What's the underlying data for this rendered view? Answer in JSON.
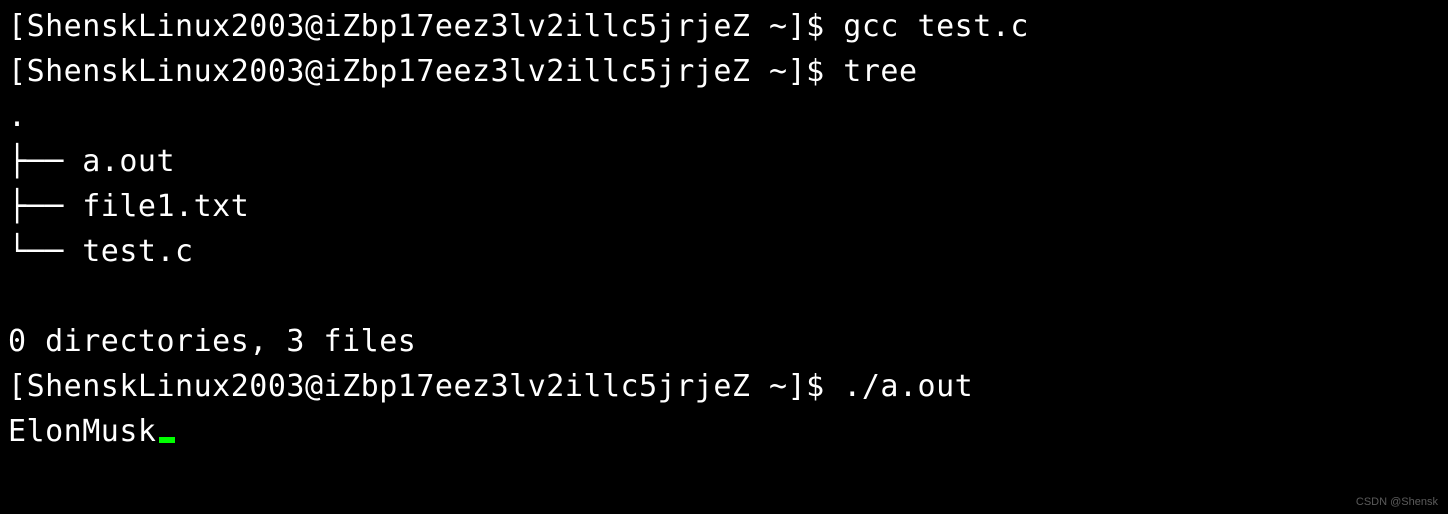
{
  "prompt_user": "ShenskLinux2003",
  "prompt_host": "iZbp17eez3lv2illc5jrjeZ",
  "prompt_dir": "~",
  "prompt_symbol": "$",
  "commands": {
    "cmd1": "gcc test.c",
    "cmd2": "tree",
    "cmd3": "./a.out"
  },
  "tree_output": {
    "root_marker": ".",
    "branch_mid": "├── ",
    "branch_last": "└── ",
    "files": {
      "f0": "a.out",
      "f1": "file1.txt",
      "f2": "test.c"
    },
    "summary": "0 directories, 3 files"
  },
  "program_output": "ElonMusk",
  "watermark": "CSDN @Shensk"
}
